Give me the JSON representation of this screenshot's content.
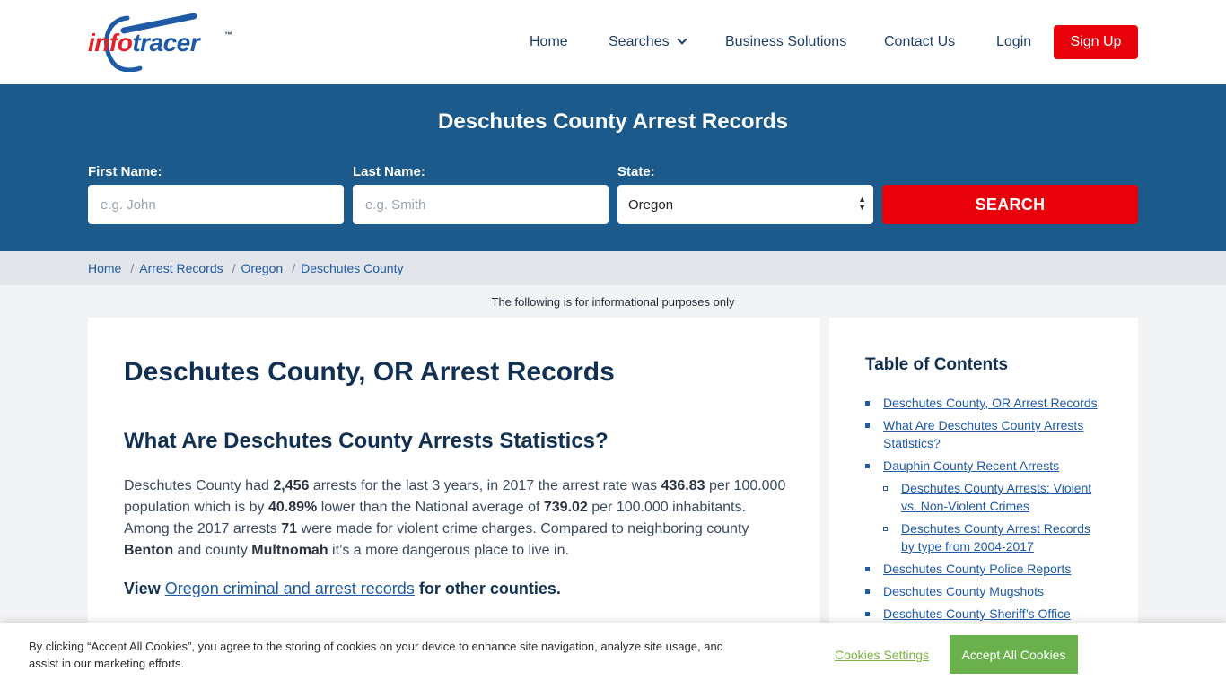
{
  "header": {
    "logo_info": "info",
    "logo_tracer": "tracer",
    "logo_tm": "™",
    "nav": {
      "home": "Home",
      "searches": "Searches",
      "business": "Business Solutions",
      "contact": "Contact Us",
      "login": "Login",
      "signup": "Sign Up"
    }
  },
  "search": {
    "title": "Deschutes County Arrest Records",
    "first_label": "First Name:",
    "first_placeholder": "e.g. John",
    "last_label": "Last Name:",
    "last_placeholder": "e.g. Smith",
    "state_label": "State:",
    "state_value": "Oregon",
    "button": "SEARCH"
  },
  "breadcrumb": [
    "Home",
    "Arrest Records",
    "Oregon",
    "Deschutes County"
  ],
  "notice": "The following is for informational purposes only",
  "main": {
    "h1": "Deschutes County, OR Arrest Records",
    "h2": "What Are Deschutes County Arrests Statistics?",
    "para": {
      "t1": "Deschutes County had ",
      "arrests": "2,456",
      "t2": " arrests for the last 3 years, in 2017 the arrest rate was ",
      "rate": "436.83",
      "t3": " per 100.000 population which is by ",
      "pct": "40.89%",
      "t4": " lower than the National average of ",
      "national": "739.02",
      "t5": " per 100.000 inhabitants. Among the 2017 arrests ",
      "violent": "71",
      "t6": " were made for violent crime charges. Compared to neighboring county ",
      "county1": "Benton",
      "t7": " and county ",
      "county2": "Multnomah",
      "t8": " it’s a more dangerous place to live in."
    },
    "view_prefix": "View ",
    "view_link": "Oregon criminal and arrest records",
    "view_suffix": " for other counties."
  },
  "toc": {
    "title": "Table of Contents",
    "items": [
      "Deschutes County, OR Arrest Records",
      "What Are Deschutes County Arrests Statistics?",
      "Dauphin County Recent Arrests",
      "Deschutes County Arrests: Violent vs. Non-Violent Crimes",
      "Deschutes County Arrest Records by type from 2004-2017",
      "Deschutes County Police Reports",
      "Deschutes County Mugshots",
      "Deschutes County Sheriff’s Office"
    ]
  },
  "cookie": {
    "text": "By clicking “Accept All Cookies”, you agree to the storing of cookies on your device to enhance site navigation, analyze site usage, and assist in our marketing efforts.",
    "settings": "Cookies Settings",
    "accept": "Accept All Cookies"
  },
  "colors": {
    "brand_blue": "#1b5a8a",
    "brand_red": "#e8000b",
    "link_blue": "#1f5aa6",
    "heading_navy": "#123152",
    "cookie_green": "#6ab04c"
  }
}
